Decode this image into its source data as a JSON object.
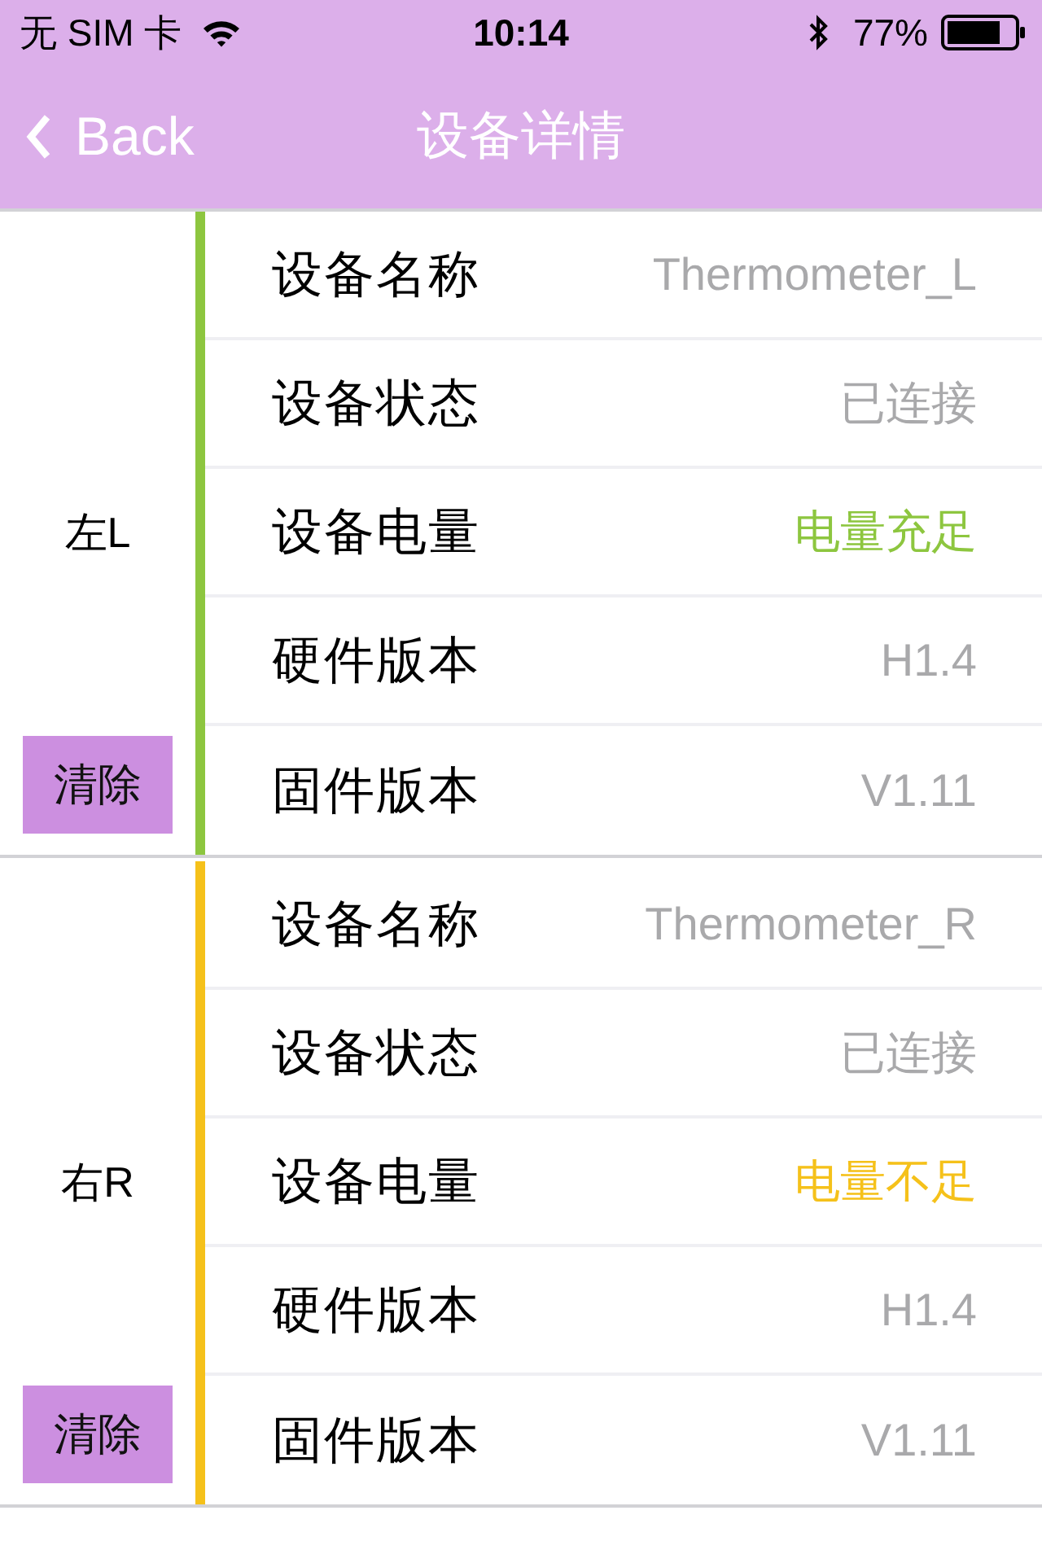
{
  "status_bar": {
    "carrier": "无 SIM 卡",
    "time": "10:14",
    "battery": "77%"
  },
  "nav": {
    "back": "Back",
    "title": "设备详情"
  },
  "devices": [
    {
      "side": "左L",
      "color": "#8dc63f",
      "clear": "清除",
      "rows": [
        {
          "label": "设备名称",
          "value": "Thermometer_L",
          "kind": "plain"
        },
        {
          "label": "设备状态",
          "value": "已连接",
          "kind": "plain"
        },
        {
          "label": "设备电量",
          "value": "电量充足",
          "kind": "battery"
        },
        {
          "label": "硬件版本",
          "value": "H1.4",
          "kind": "plain"
        },
        {
          "label": "固件版本",
          "value": "V1.11",
          "kind": "plain"
        }
      ]
    },
    {
      "side": "右R",
      "color": "#f5c11a",
      "clear": "清除",
      "rows": [
        {
          "label": "设备名称",
          "value": "Thermometer_R",
          "kind": "plain"
        },
        {
          "label": "设备状态",
          "value": "已连接",
          "kind": "plain"
        },
        {
          "label": "设备电量",
          "value": "电量不足",
          "kind": "battery"
        },
        {
          "label": "硬件版本",
          "value": "H1.4",
          "kind": "plain"
        },
        {
          "label": "固件版本",
          "value": "V1.11",
          "kind": "plain"
        }
      ]
    }
  ]
}
